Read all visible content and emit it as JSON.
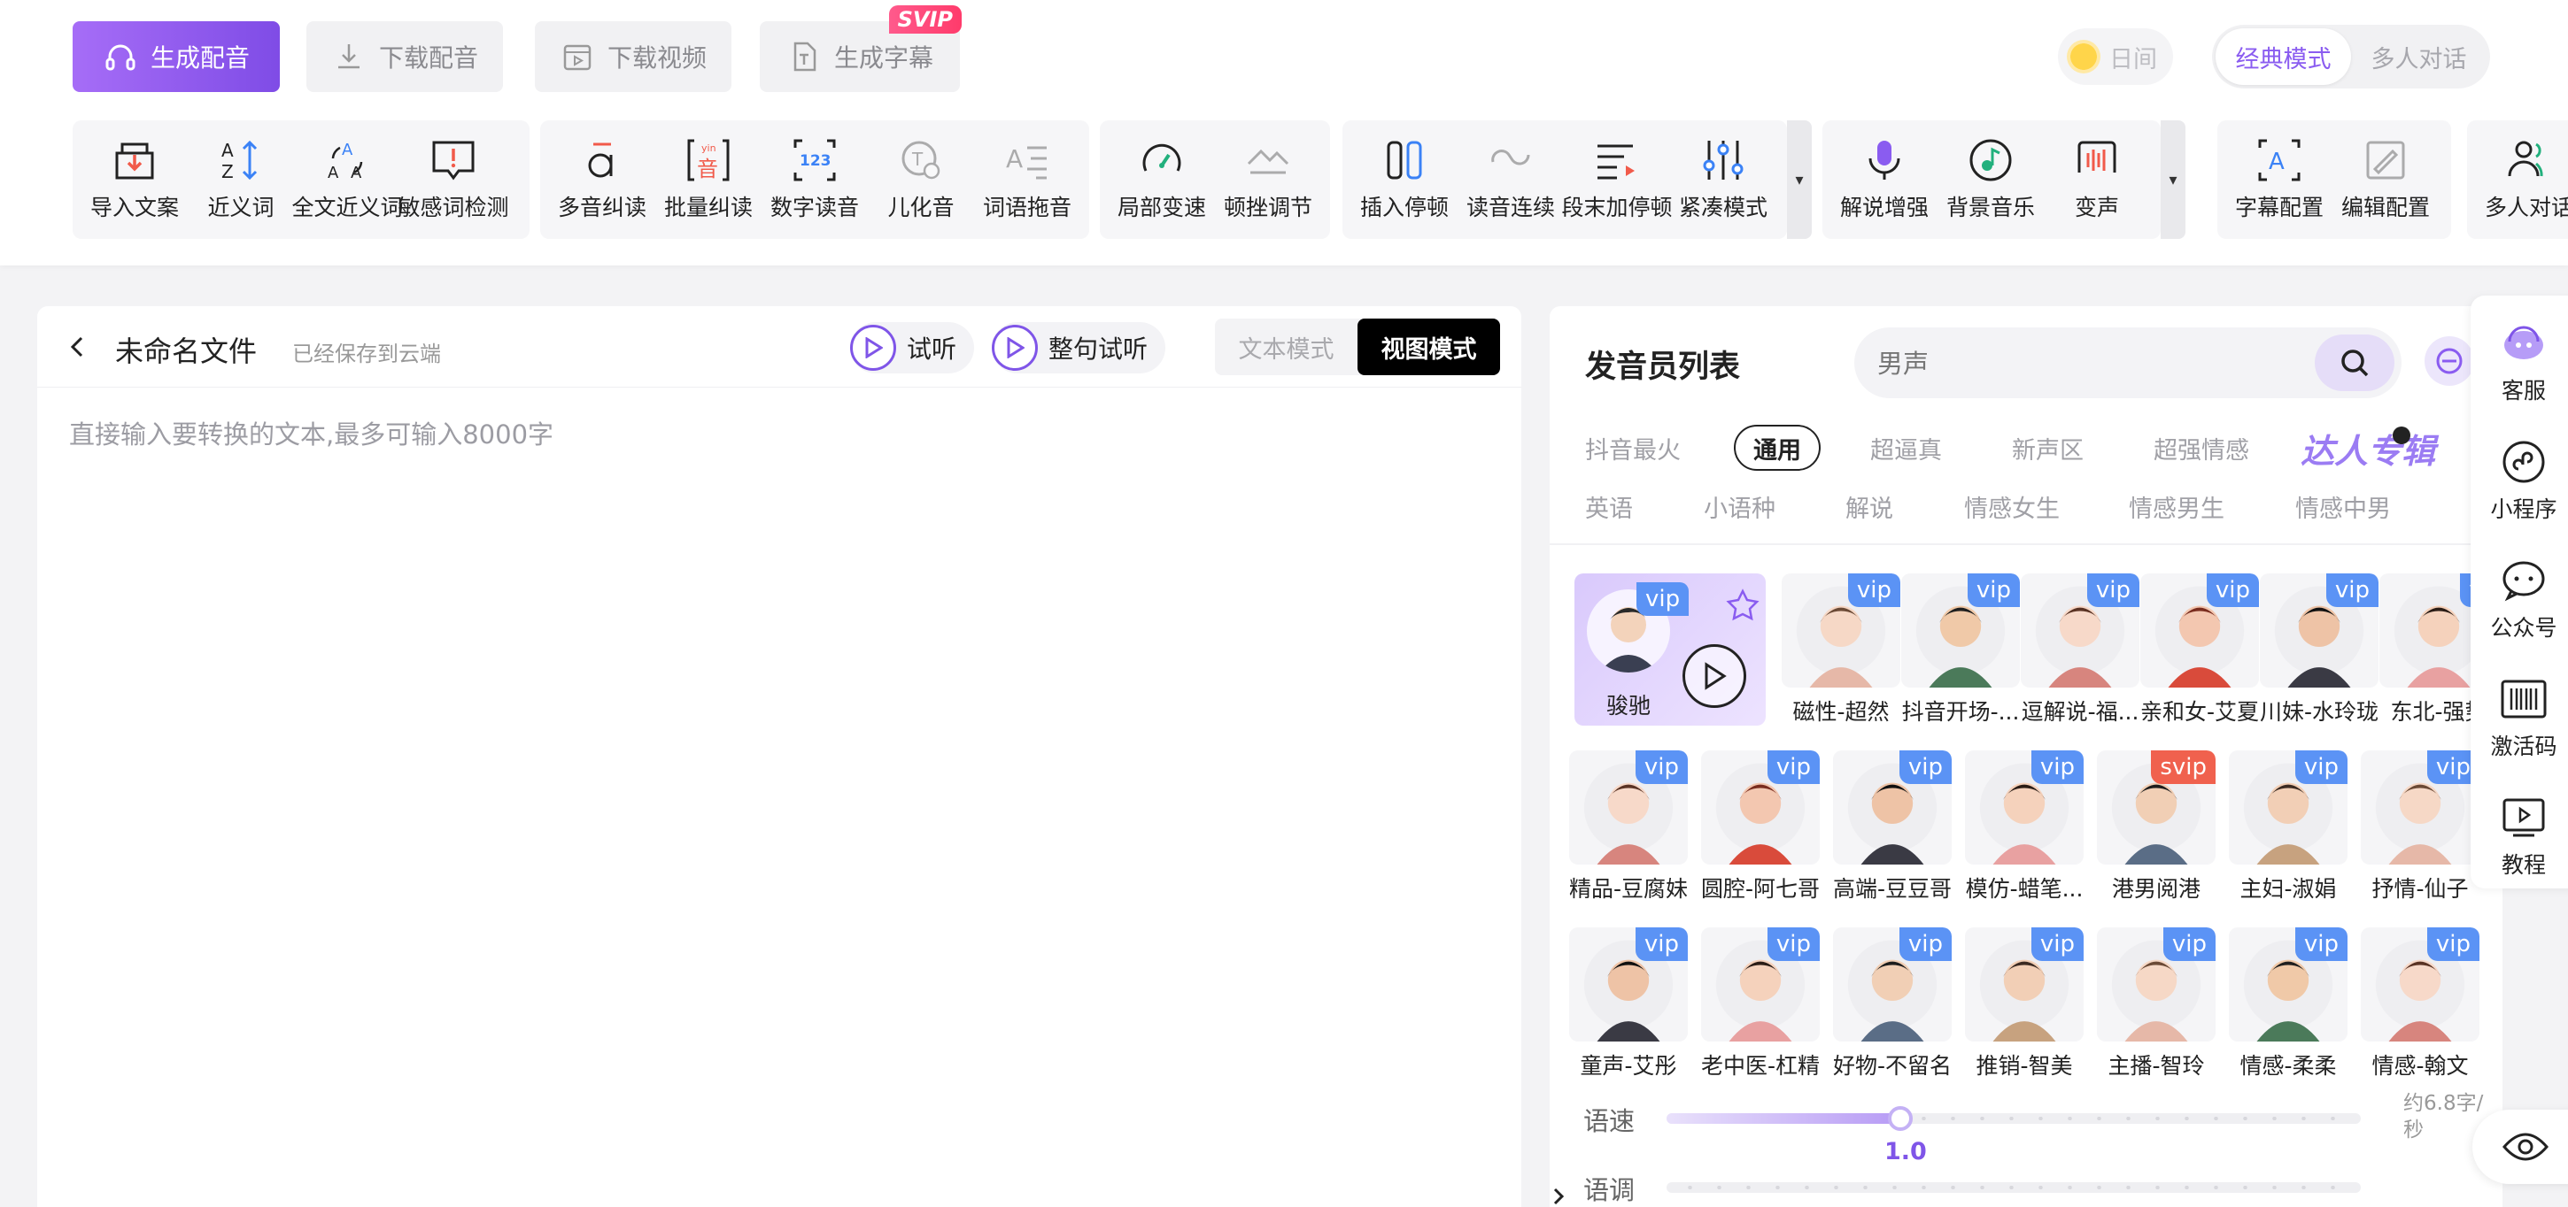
{
  "actions": {
    "generate": "生成配音",
    "download_audio": "下载配音",
    "download_video": "下载视频",
    "subtitles": "生成字幕",
    "svip": "SVIP"
  },
  "theme": {
    "day_label": "日间"
  },
  "modes": {
    "classic": "经典模式",
    "multi": "多人对话"
  },
  "toolbar": {
    "group1": [
      "导入文案",
      "近义词",
      "全文近义词",
      "敏感词检测"
    ],
    "group2": [
      "多音纠读",
      "批量纠读",
      "数字读音",
      "儿化音",
      "词语拖音"
    ],
    "group3": [
      "局部变速",
      "顿挫调节"
    ],
    "group4": [
      "插入停顿",
      "读音连续",
      "段末加停顿",
      "紧凑模式"
    ],
    "group5": [
      "解说增强",
      "背景音乐",
      "变声"
    ],
    "group6": [
      "字幕配置",
      "编辑配置"
    ],
    "group7": [
      "多人对话"
    ]
  },
  "editor": {
    "title": "未命名文件",
    "saved": "已经保存到云端",
    "listen": "试听",
    "listen_all": "整句试听",
    "text_mode": "文本模式",
    "view_mode": "视图模式",
    "placeholder": "直接输入要转换的文本,最多可输入8000字"
  },
  "voices": {
    "title": "发音员列表",
    "search_placeholder": "男声",
    "categories_row1": [
      "抖音最火",
      "通用",
      "超逼真",
      "新声区",
      "超强情感",
      "达人专辑"
    ],
    "categories_row2": [
      "英语",
      "小语种",
      "解说",
      "情感女生",
      "情感男生",
      "情感中男"
    ],
    "selected": {
      "name": "骏驰",
      "badge": "vip"
    },
    "row1": [
      {
        "name": "磁性-超然",
        "badge": "vip"
      },
      {
        "name": "抖音开场-...",
        "badge": "vip"
      },
      {
        "name": "逗解说-福...",
        "badge": "vip"
      },
      {
        "name": "亲和女-艾夏",
        "badge": "vip"
      },
      {
        "name": "川妹-水玲珑",
        "badge": "vip"
      },
      {
        "name": "东北-强势",
        "badge": "vi"
      }
    ],
    "row2": [
      {
        "name": "精品-豆腐妹",
        "badge": "vip"
      },
      {
        "name": "圆腔-阿七哥",
        "badge": "vip"
      },
      {
        "name": "高端-豆豆哥",
        "badge": "vip"
      },
      {
        "name": "模仿-蜡笔...",
        "badge": "vip"
      },
      {
        "name": "港男阅港",
        "badge": "svip"
      },
      {
        "name": "主妇-淑娟",
        "badge": "vip"
      },
      {
        "name": "抒情-仙子",
        "badge": "vip"
      }
    ],
    "row3": [
      {
        "name": "童声-艾彤",
        "badge": "vip"
      },
      {
        "name": "老中医-杠精",
        "badge": "vip"
      },
      {
        "name": "好物-不留名",
        "badge": "vip"
      },
      {
        "name": "推销-智美",
        "badge": "vip"
      },
      {
        "name": "主播-智玲",
        "badge": "vip"
      },
      {
        "name": "情感-柔柔",
        "badge": "vip"
      },
      {
        "name": "情感-翰文",
        "badge": "vip"
      }
    ],
    "speed_label": "语速",
    "speed_value": "1.0",
    "speed_hint": "约6.8字/秒",
    "pitch_label": "语调"
  },
  "float_bar": [
    "客服",
    "小程序",
    "公众号",
    "激活码",
    "教程"
  ],
  "colors": {
    "accent": "#8a5cf0",
    "vip": "#5b93f5",
    "svip": "#f0614e"
  }
}
